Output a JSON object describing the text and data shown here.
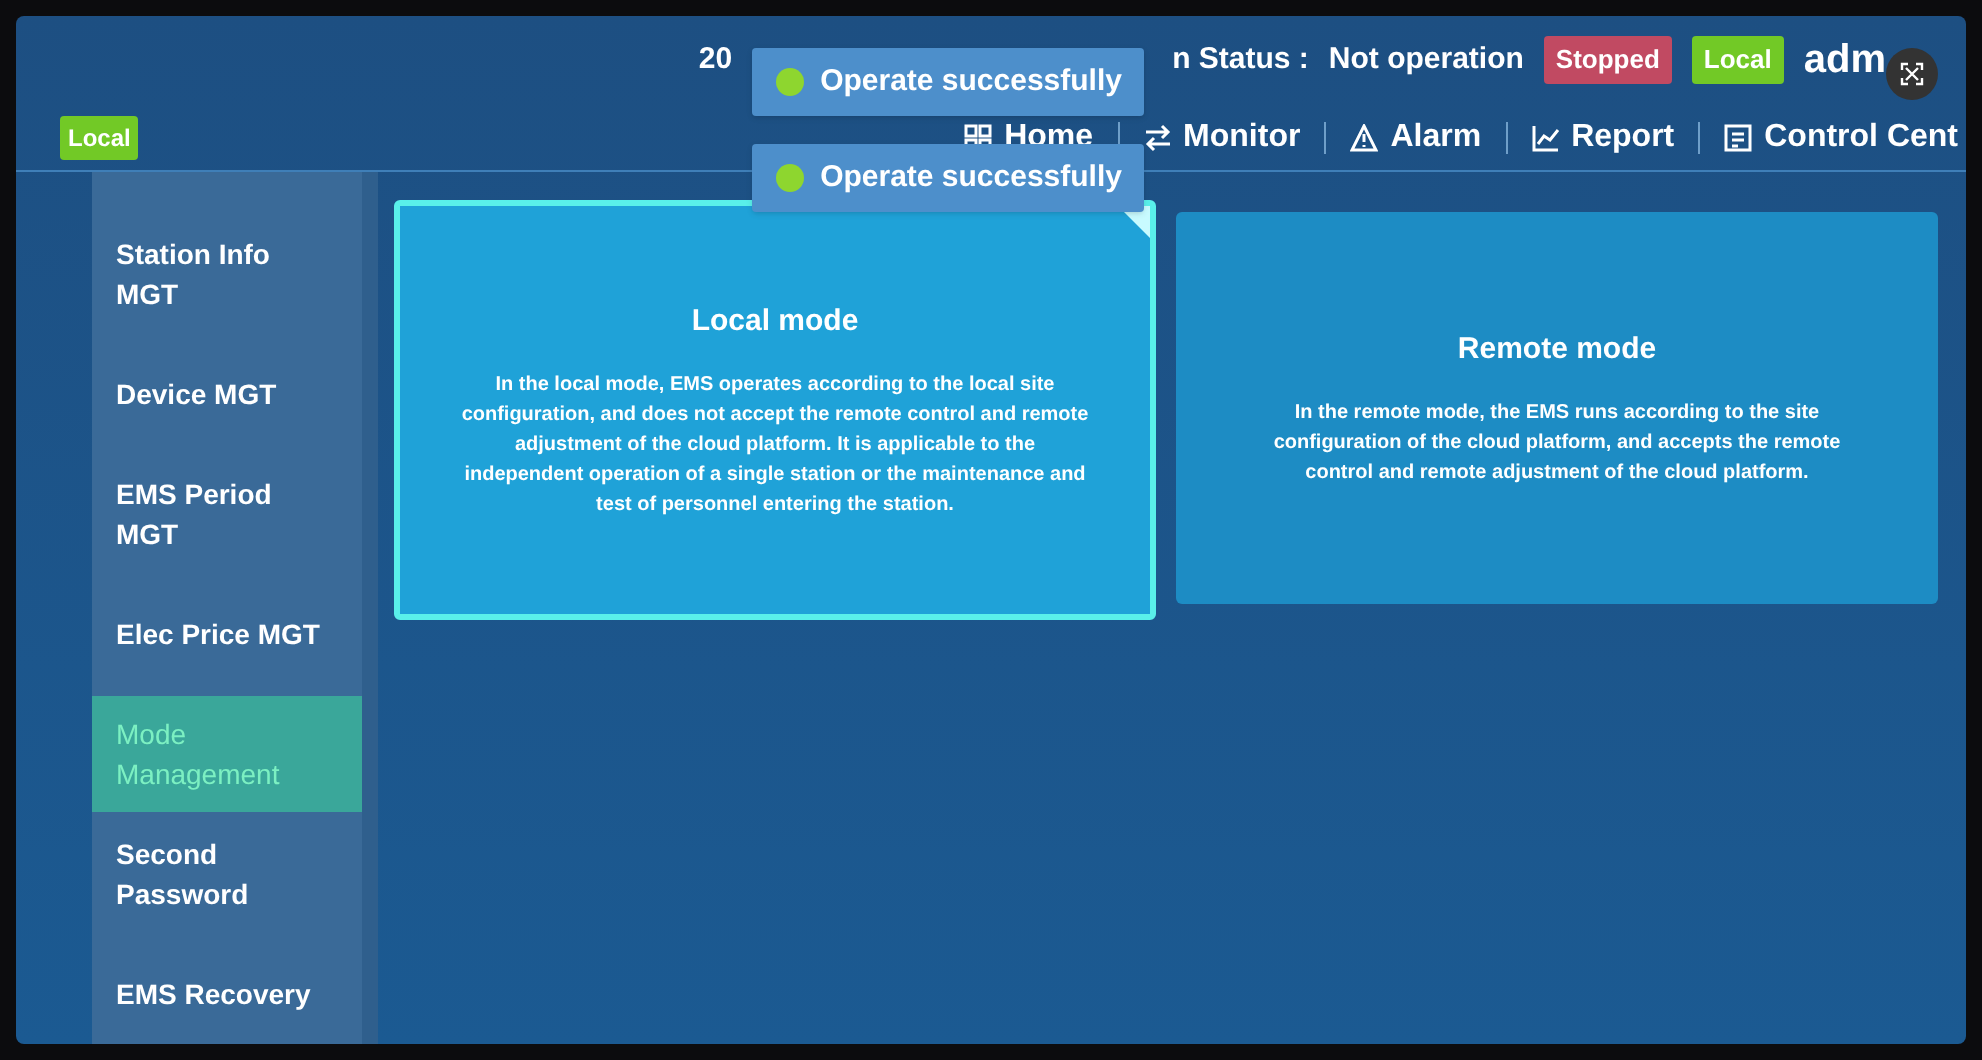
{
  "header": {
    "time_fragment": "20",
    "status_label": "n Status :",
    "status_value": "Not operation",
    "run_badge": "Stopped",
    "mode_badge": "Local",
    "user": "adm"
  },
  "corner_badge": "Local",
  "toasts": [
    "Operate successfully",
    "Operate successfully"
  ],
  "nav": [
    {
      "label": "Home",
      "kind": "grid"
    },
    {
      "label": "Monitor",
      "kind": "swap"
    },
    {
      "label": "Alarm",
      "kind": "warning"
    },
    {
      "label": "Report",
      "kind": "chart"
    },
    {
      "label": "Control Cent",
      "kind": "panel"
    }
  ],
  "sidebar": [
    {
      "label": "Station Info MGT",
      "selected": false
    },
    {
      "label": "Device MGT",
      "selected": false
    },
    {
      "label": "EMS Period MGT",
      "selected": false
    },
    {
      "label": "Elec Price MGT",
      "selected": false
    },
    {
      "label": "Mode Management",
      "selected": true
    },
    {
      "label": "Second Password",
      "selected": false
    },
    {
      "label": "EMS Recovery",
      "selected": false
    }
  ],
  "modes": [
    {
      "title": "Local mode",
      "description": "In the local mode, EMS operates according to the local site configuration, and does not accept the remote control and remote adjustment of the cloud platform. It is applicable to the independent operation of a single station or the maintenance and test of personnel entering the station.",
      "selected": true
    },
    {
      "title": "Remote mode",
      "description": "In the remote mode, the EMS runs according to the site configuration of the cloud platform, and accepts the remote control and remote adjustment of the cloud platform.",
      "selected": false
    }
  ]
}
